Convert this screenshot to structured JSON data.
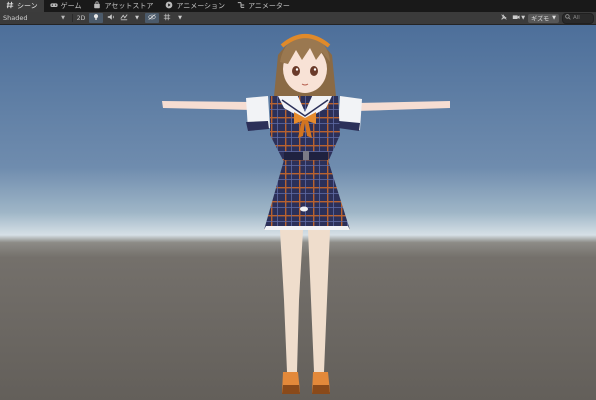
{
  "tabs": [
    {
      "label": "シーン",
      "icon": "hashtag-icon",
      "active": true
    },
    {
      "label": "ゲーム",
      "icon": "gamepad-icon",
      "active": false
    },
    {
      "label": "アセットストア",
      "icon": "shopping-bag-icon",
      "active": false
    },
    {
      "label": "アニメーション",
      "icon": "play-circle-icon",
      "active": false
    },
    {
      "label": "アニメーター",
      "icon": "animator-icon",
      "active": false
    }
  ],
  "toolbar": {
    "shading_mode": "Shaded",
    "mode_2d": "2D",
    "gizmos_label": "ギズモ",
    "search_label": "All"
  },
  "colors": {
    "tab_bar_bg": "#191919",
    "toolbar_bg": "#3b3b3b",
    "sky_top": "#4d6f9a",
    "horizon": "#d6e0e6",
    "ground": "#635f5a",
    "uniform_navy": "#2b2f57",
    "plaid_orange": "#c7682d",
    "bow_orange": "#e58a2c"
  }
}
